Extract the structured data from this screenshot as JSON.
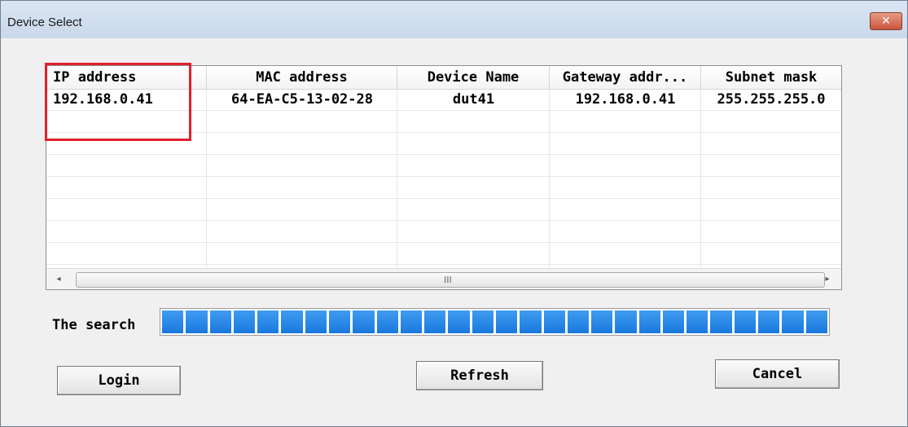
{
  "window": {
    "title": "Device Select",
    "close_glyph": "✕"
  },
  "table": {
    "columns": [
      "IP address",
      "MAC address",
      "Device Name",
      "Gateway addr...",
      "Subnet mask"
    ],
    "rows": [
      [
        "192.168.0.41",
        "64-EA-C5-13-02-28",
        "dut41",
        "192.168.0.41",
        "255.255.255.0"
      ]
    ]
  },
  "scrollbar": {
    "left_glyph": "◂",
    "right_glyph": "▸",
    "grip_glyph": "III"
  },
  "search": {
    "label": "The search",
    "progress_percent": 100
  },
  "buttons": {
    "login": "Login",
    "refresh": "Refresh",
    "cancel": "Cancel"
  },
  "colors": {
    "highlight": "#e0202a",
    "progress": "#2584e6"
  }
}
